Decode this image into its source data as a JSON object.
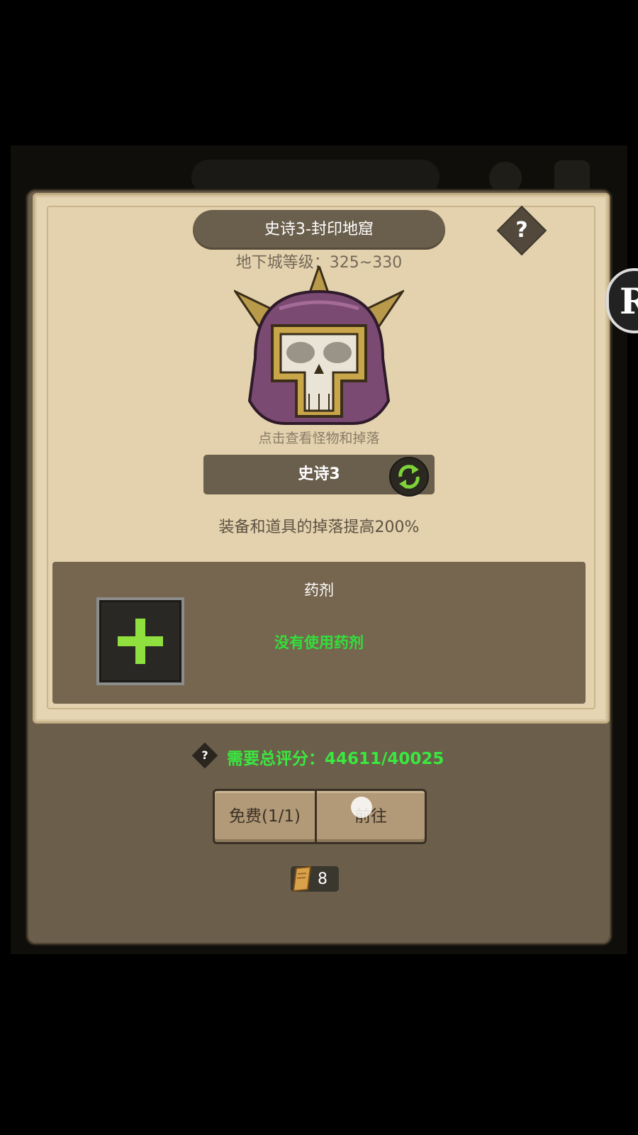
{
  "dialog": {
    "title": "史诗3-封印地窟",
    "help_symbol": "?",
    "level_range": "地下城等级：325~330",
    "monster_hint": "点击查看怪物和掉落",
    "difficulty_label": "史诗3",
    "drop_bonus": "装备和道具的掉落提高200%"
  },
  "potion": {
    "title": "药剂",
    "status": "没有使用药剂"
  },
  "requirement": {
    "help_symbol": "?",
    "score_text": "需要总评分：44611/40025"
  },
  "buttons": {
    "free_label": "免费(1/1)",
    "go_label": "前往"
  },
  "ticket": {
    "count": "8"
  },
  "colors": {
    "panel_brown": "#6b5e4a",
    "parchment": "#e5d5b3",
    "accent_green": "#31e03a",
    "plus_green": "#8fe03f"
  },
  "icons": [
    "help-icon",
    "monster-skull-helmet-icon",
    "swap-difficulty-icon",
    "add-potion-plus-icon",
    "ticket-scroll-icon"
  ]
}
